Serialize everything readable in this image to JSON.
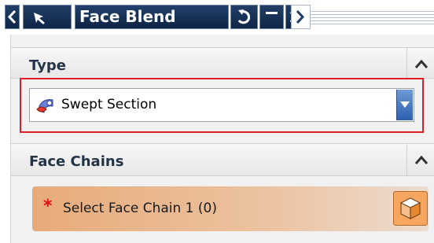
{
  "titlebar": {
    "title": "Face Blend",
    "icons": [
      "chevron-left-icon",
      "select-arrow-icon",
      "reset-icon",
      "minimize-icon",
      "close-icon",
      "chevron-right-icon"
    ]
  },
  "type_section": {
    "title": "Type",
    "collapse_icon": "chevron-up-icon",
    "selected_value": "Swept Section",
    "value_icon": "swept-section-icon"
  },
  "face_chains_section": {
    "title": "Face Chains",
    "collapse_icon": "chevron-up-icon",
    "required_marker": "*",
    "select_label": "Select Face Chain 1 (0)",
    "select_icon": "face-select-icon"
  },
  "colors": {
    "title_bar": "#15305a",
    "highlight": "#e01e25",
    "select_row": "#e7ab7b",
    "select_button": "#f7a65f"
  }
}
